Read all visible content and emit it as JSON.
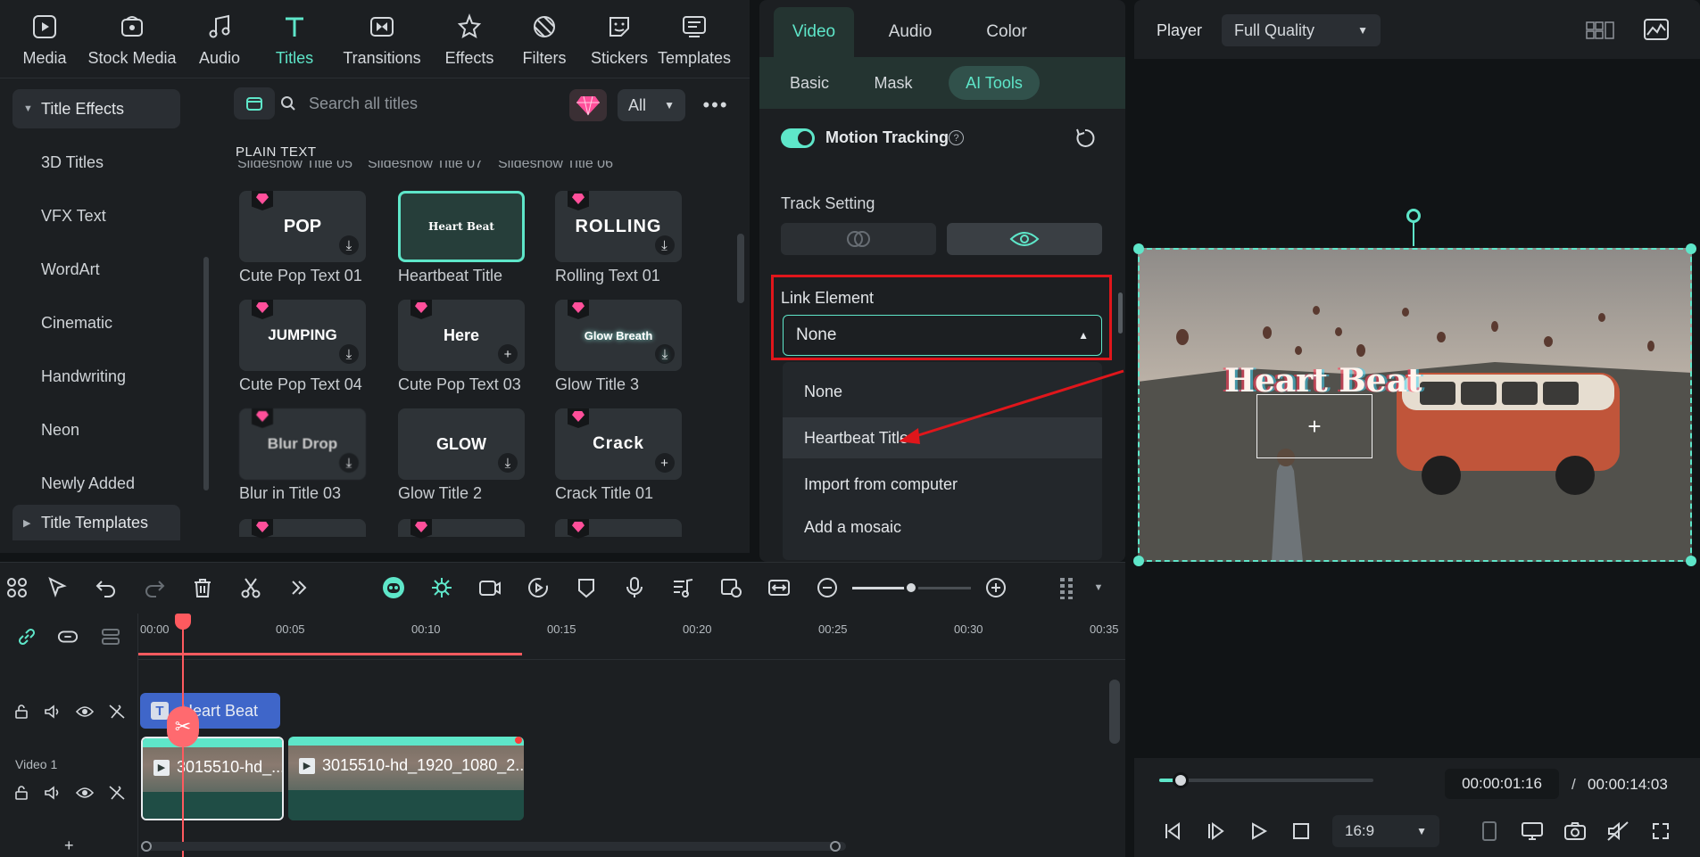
{
  "library": {
    "tabs": [
      {
        "label": "Media",
        "icon": "media-icon"
      },
      {
        "label": "Stock Media",
        "icon": "stock-media-icon"
      },
      {
        "label": "Audio",
        "icon": "audio-icon"
      },
      {
        "label": "Titles",
        "icon": "titles-icon",
        "active": true
      },
      {
        "label": "Transitions",
        "icon": "transitions-icon"
      },
      {
        "label": "Effects",
        "icon": "effects-icon"
      },
      {
        "label": "Filters",
        "icon": "filters-icon"
      },
      {
        "label": "Stickers",
        "icon": "stickers-icon"
      },
      {
        "label": "Templates",
        "icon": "templates-icon"
      }
    ],
    "sidebar": [
      {
        "label": "Title Effects",
        "group": true,
        "expanded": true
      },
      {
        "label": "3D Titles"
      },
      {
        "label": "VFX Text"
      },
      {
        "label": "WordArt"
      },
      {
        "label": "Cinematic"
      },
      {
        "label": "Handwriting"
      },
      {
        "label": "Neon"
      },
      {
        "label": "Newly Added"
      },
      {
        "label": "Title Templates",
        "group": true,
        "expanded": false
      }
    ],
    "search_placeholder": "Search all titles",
    "filter_value": "All",
    "more_label": "•••",
    "section_label": "PLAIN TEXT",
    "cutoff_labels": [
      "Slideshow Title 05",
      "Slideshow Title 07",
      "Slideshow Title 06"
    ],
    "tiles": [
      {
        "preview": "POP",
        "label": "Cute Pop Text 01",
        "premium": true,
        "action": "download"
      },
      {
        "preview": "Heart Beat",
        "label": "Heartbeat Title",
        "premium": false,
        "action": "",
        "selected": true
      },
      {
        "preview": "ROLLING",
        "label": "Rolling Text 01",
        "premium": true,
        "action": "download"
      },
      {
        "preview": "JUMPING",
        "label": "Cute Pop Text 04",
        "premium": true,
        "action": "download"
      },
      {
        "preview": "Here",
        "label": "Cute Pop Text 03",
        "premium": true,
        "action": "add"
      },
      {
        "preview": "Glow Breath",
        "label": "Glow Title 3",
        "premium": true,
        "action": "download"
      },
      {
        "preview": "Blur Drop",
        "label": "Blur in Title 03",
        "premium": true,
        "action": "download"
      },
      {
        "preview": "GLOW",
        "label": "Glow Title 2",
        "premium": false,
        "action": "download"
      },
      {
        "preview": "Crack",
        "label": "Crack Title 01",
        "premium": true,
        "action": "add"
      }
    ],
    "download_glyph": "⤓",
    "add_glyph": "+"
  },
  "properties": {
    "tabs": [
      "Video",
      "Audio",
      "Color"
    ],
    "active_tab": "Video",
    "subtabs": [
      "Basic",
      "Mask",
      "AI Tools"
    ],
    "active_subtab": "AI Tools",
    "motion_tracking_label": "Motion Tracking",
    "motion_tracking_on": true,
    "help_glyph": "?",
    "track_setting_label": "Track Setting",
    "link_element_label": "Link Element",
    "link_element_value": "None",
    "dropdown_options": [
      "None",
      "Heartbeat Title",
      "Import from computer",
      "Add a mosaic"
    ],
    "highlighted_option": "Heartbeat Title",
    "annotation_color": "#e0161b"
  },
  "player": {
    "title": "Player",
    "quality": "Full Quality",
    "overlay_title": "Heart Beat",
    "current_time": "00:00:01:16",
    "separator": "/",
    "total_time": "00:00:14:03",
    "progress": 0.1,
    "aspect_ratio": "16:9"
  },
  "timeline": {
    "ruler": [
      "00:00",
      "00:05",
      "00:10",
      "00:15",
      "00:20",
      "00:25",
      "00:30",
      "00:35"
    ],
    "text_clip_label": "Heart Beat",
    "track_label": "Video 1",
    "video_clips": [
      "3015510-hd_...",
      "3015510-hd_1920_1080_2..."
    ],
    "add_track_glyph": "+"
  },
  "colors": {
    "accent": "#5ee6c9",
    "panel": "#1c1f22",
    "playhead": "#ff5a5f",
    "text_clip": "#3f66c9",
    "annotation": "#e0161b"
  }
}
